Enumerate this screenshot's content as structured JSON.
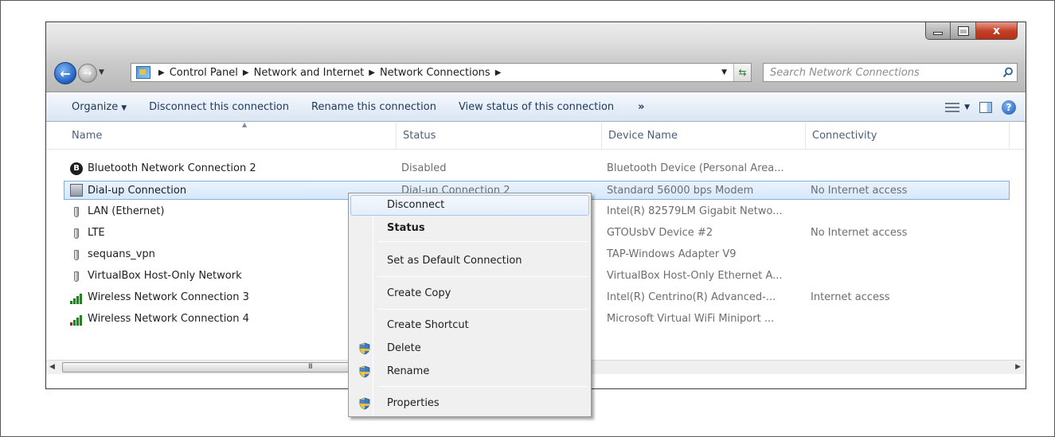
{
  "window": {
    "caption_buttons": {
      "minimize": "",
      "maximize": "",
      "close": "x"
    }
  },
  "navigation": {
    "breadcrumbs": [
      "Control Panel",
      "Network and Internet",
      "Network Connections"
    ],
    "search_placeholder": "Search Network Connections"
  },
  "commandbar": {
    "organize": "Organize",
    "disconnect": "Disconnect this connection",
    "rename": "Rename this connection",
    "view_status": "View status of this connection",
    "more": "»"
  },
  "columns": {
    "name": "Name",
    "status": "Status",
    "device": "Device Name",
    "connectivity": "Connectivity"
  },
  "connections": [
    {
      "name": "Bluetooth Network Connection 2",
      "status": "Disabled",
      "device": "Bluetooth Device (Personal Area...",
      "connectivity": "",
      "icon": "bluetooth-icon"
    },
    {
      "name": "Dial-up Connection",
      "status": "Dial-up Connection 2",
      "device": "Standard 56000 bps Modem",
      "connectivity": "No Internet access",
      "icon": "modem-icon",
      "selected": true
    },
    {
      "name": "LAN (Ethernet)",
      "status": "",
      "device": "Intel(R) 82579LM Gigabit Netwo...",
      "connectivity": "",
      "icon": "ethernet-plug-icon"
    },
    {
      "name": "LTE",
      "status": "",
      "device": "GTOUsbV Device #2",
      "connectivity": "No Internet access",
      "icon": "ethernet-plug-icon"
    },
    {
      "name": "sequans_vpn",
      "status": "",
      "device": "TAP-Windows Adapter V9",
      "connectivity": "",
      "icon": "ethernet-plug-icon"
    },
    {
      "name": "VirtualBox Host-Only Network",
      "status": "",
      "device": "VirtualBox Host-Only Ethernet A...",
      "connectivity": "",
      "icon": "ethernet-plug-icon"
    },
    {
      "name": "Wireless Network Connection 3",
      "status": "",
      "device": "Intel(R) Centrino(R) Advanced-...",
      "connectivity": "Internet access",
      "icon": "wifi-signal-icon"
    },
    {
      "name": "Wireless Network Connection 4",
      "status": "",
      "device": "Microsoft Virtual WiFi Miniport ...",
      "connectivity": "",
      "icon": "wifi-signal-disconnected-icon"
    }
  ],
  "hscroll_grip": "III",
  "context_menu": {
    "disconnect": "Disconnect",
    "status": "Status",
    "set_default": "Set as Default Connection",
    "create_copy": "Create Copy",
    "create_shortcut": "Create Shortcut",
    "delete": "Delete",
    "rename": "Rename",
    "properties": "Properties"
  },
  "colors": {
    "commandbar_text": "#1e395b",
    "selection_border": "#84acdd",
    "column_header_text": "#4c607a",
    "wifi_green": "#2f9c2f"
  }
}
